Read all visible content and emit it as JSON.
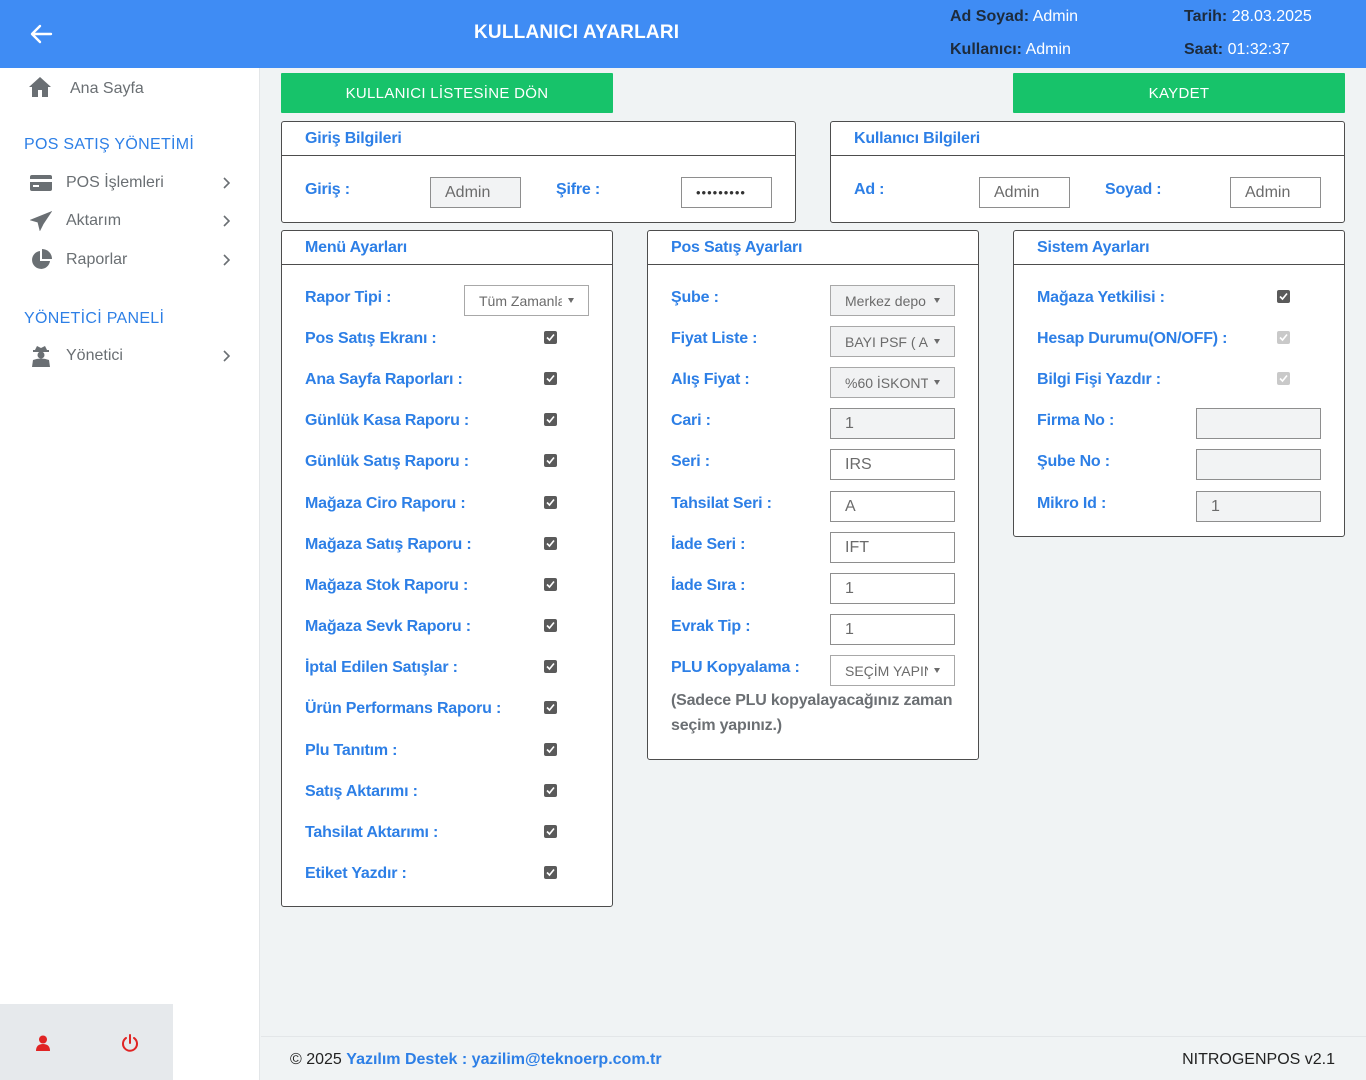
{
  "header": {
    "title": "KULLANICI AYARLARI",
    "ad_soyad_label": "Ad Soyad:",
    "ad_soyad_value": "Admin",
    "kullanici_label": "Kullanıcı:",
    "kullanici_value": "Admin",
    "tarih_label": "Tarih:",
    "tarih_value": "28.03.2025",
    "saat_label": "Saat:",
    "saat_value": "01:32:37"
  },
  "sidebar": {
    "home": "Ana Sayfa",
    "section_pos": "POS SATIŞ YÖNETİMİ",
    "section_admin": "YÖNETİCİ PANELİ",
    "items": [
      "POS İşlemleri",
      "Aktarım",
      "Raporlar",
      "Yönetici"
    ]
  },
  "buttons": {
    "back_to_list": "KULLANICI LİSTESİNE DÖN",
    "save": "KAYDET"
  },
  "login": {
    "title": "Giriş Bilgileri",
    "user_label": "Giriş :",
    "user_value": "Admin",
    "password_label": "Şifre :",
    "password_value": "•••••••••"
  },
  "user_info": {
    "title": "Kullanıcı Bilgileri",
    "first_label": "Ad :",
    "first_value": "Admin",
    "last_label": "Soyad :",
    "last_value": "Admin"
  },
  "menu": {
    "title": "Menü Ayarları",
    "report_type_label": "Rapor Tipi :",
    "report_type_value": "Tüm Zamanlar",
    "items": [
      {
        "label": "Pos Satış Ekranı :",
        "checked": true
      },
      {
        "label": "Ana Sayfa Raporları :",
        "checked": true
      },
      {
        "label": "Günlük Kasa Raporu :",
        "checked": true
      },
      {
        "label": "Günlük Satış Raporu :",
        "checked": true
      },
      {
        "label": "Mağaza Ciro Raporu :",
        "checked": true
      },
      {
        "label": "Mağaza Satış Raporu :",
        "checked": true
      },
      {
        "label": "Mağaza Stok Raporu :",
        "checked": true
      },
      {
        "label": "Mağaza Sevk Raporu :",
        "checked": true
      },
      {
        "label": "İptal Edilen Satışlar :",
        "checked": true
      },
      {
        "label": "Ürün Performans Raporu :",
        "checked": true
      },
      {
        "label": "Plu Tanıtım :",
        "checked": true
      },
      {
        "label": "Satış Aktarımı :",
        "checked": true
      },
      {
        "label": "Tahsilat Aktarımı :",
        "checked": true
      },
      {
        "label": "Etiket Yazdır :",
        "checked": true
      }
    ]
  },
  "pos": {
    "title": "Pos Satış Ayarları",
    "sube_label": "Şube :",
    "sube_value": "Merkez depo",
    "fiyat_liste_label": "Fiyat Liste :",
    "fiyat_liste_value": "BAYI PSF ( AI",
    "alis_fiyat_label": "Alış Fiyat :",
    "alis_fiyat_value": "%60 İSKONT",
    "cari_label": "Cari :",
    "cari_value": "1",
    "seri_label": "Seri :",
    "seri_value": "IRS",
    "tahsilat_seri_label": "Tahsilat Seri :",
    "tahsilat_seri_value": "A",
    "iade_seri_label": "İade Seri :",
    "iade_seri_value": "IFT",
    "iade_sira_label": "İade Sıra :",
    "iade_sira_value": "1",
    "evrak_tip_label": "Evrak Tip :",
    "evrak_tip_value": "1",
    "plu_label": "PLU Kopyalama :",
    "plu_value": "SEÇİM YAPIN",
    "plu_note": "(Sadece PLU kopyalayacağınız zaman seçim yapınız.)"
  },
  "system": {
    "title": "Sistem Ayarları",
    "yetkili_label": "Mağaza Yetkilisi :",
    "yetkili_checked": true,
    "hesap_label": "Hesap Durumu(ON/OFF) :",
    "hesap_checked": true,
    "fis_label": "Bilgi Fişi Yazdır :",
    "fis_checked": true,
    "firma_label": "Firma No :",
    "firma_value": "",
    "sube_label": "Şube No :",
    "sube_value": "",
    "mikro_label": "Mikro Id :",
    "mikro_value": "1"
  },
  "footer": {
    "copyright": "© 2025",
    "support_label": "Yazılım Destek : yazilim@teknoerp.com.tr",
    "version": "NITROGENPOS v2.1"
  },
  "colors": {
    "header": "#3f8cf4",
    "accent": "#2d7fe6",
    "button": "#17c36a",
    "logout": "#e02424"
  }
}
